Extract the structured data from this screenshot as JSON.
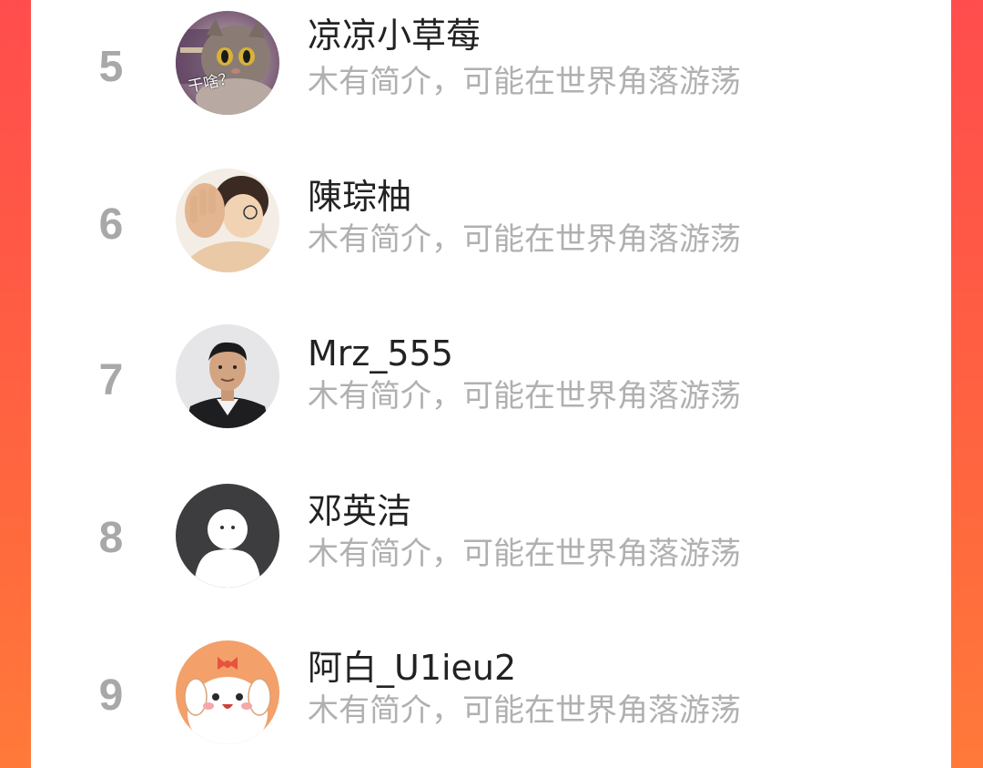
{
  "colors": {
    "panel": "#ffffff",
    "rank": "#a8a8a8",
    "name": "#222222",
    "bio": "#b0b0b0",
    "accent_left": "#ff4d4d",
    "accent_right": "#ff7a3a"
  },
  "rankings": [
    {
      "rank": "5",
      "name": "凉凉小草莓",
      "bio": "木有简介，可能在世界角落游荡",
      "avatar_icon": "cat-photo-avatar-icon",
      "avatar_caption": "干啥？"
    },
    {
      "rank": "6",
      "name": "陳琮柚",
      "bio": "木有简介，可能在世界角落游荡",
      "avatar_icon": "person-photo-avatar-icon"
    },
    {
      "rank": "7",
      "name": "Mrz_555",
      "bio": "木有简介，可能在世界角落游荡",
      "avatar_icon": "man-portrait-avatar-icon"
    },
    {
      "rank": "8",
      "name": "邓英洁",
      "bio": "木有简介，可能在世界角落游荡",
      "avatar_icon": "default-avatar-icon"
    },
    {
      "rank": "9",
      "name": "阿白_U1ieu2",
      "bio": "木有简介，可能在世界角落游荡",
      "avatar_icon": "cartoon-puppy-avatar-icon"
    }
  ]
}
